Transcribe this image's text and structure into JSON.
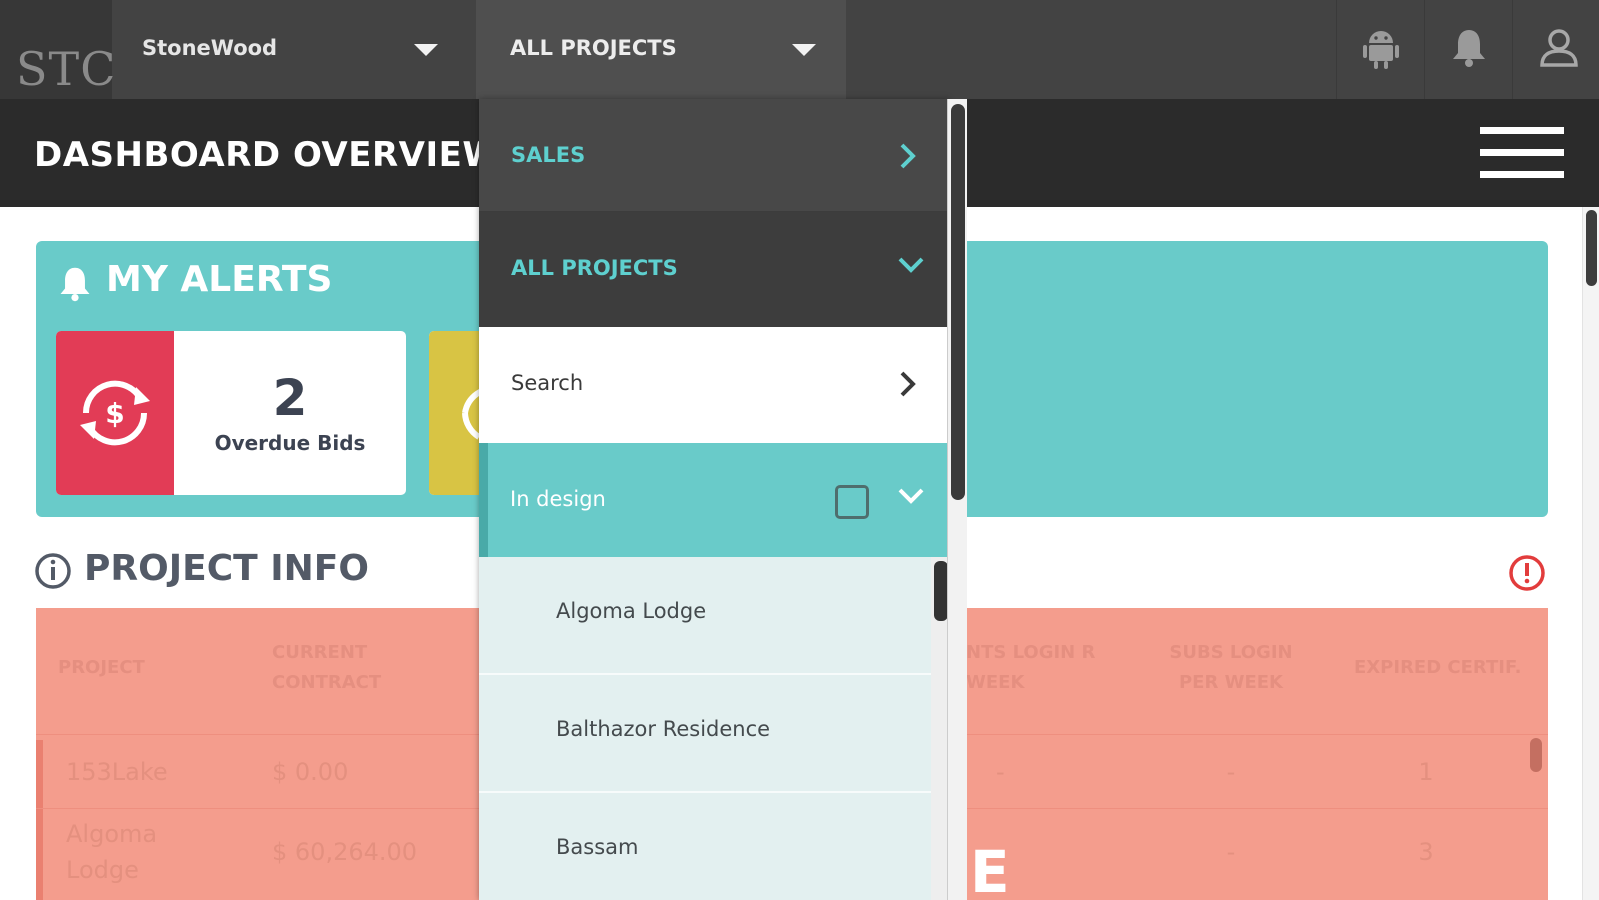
{
  "topbar": {
    "logo": "STC",
    "company_label": "StoneWood",
    "project_select_label": "ALL PROJECTS",
    "icons": [
      "android-icon",
      "bell-icon",
      "user-icon"
    ]
  },
  "title_bar": {
    "title": "DASHBOARD OVERVIEW",
    "menu_icon": "hamburger-icon"
  },
  "alerts": {
    "title": "MY ALERTS",
    "cards": [
      {
        "count": "2",
        "label": "Overdue Bids",
        "color": "#e23c56",
        "icon": "dollar-cycle-icon"
      },
      {
        "count": "",
        "label": "",
        "color": "#d8c444",
        "icon": "cycle-icon"
      }
    ]
  },
  "project_info": {
    "title": "PROJECT INFO",
    "columns": [
      "PROJECT",
      "CURRENT CONTRACT",
      "NTS LOGIN R WEEK",
      "SUBS LOGIN PER WEEK",
      "EXPIRED CERTIF."
    ],
    "rows": [
      {
        "project": "153Lake",
        "contract": "$ 0.00",
        "clients_login": "-",
        "subs_login": "-",
        "expired": "1"
      },
      {
        "project": "Algoma Lodge",
        "contract": "$ 60,264.00",
        "clients_login": "E",
        "subs_login": "-",
        "expired": "3"
      }
    ]
  },
  "dropdown": {
    "sales_label": "SALES",
    "all_projects_label": "ALL PROJECTS",
    "search_label": "Search",
    "group_label": "In design",
    "projects": [
      "Algoma Lodge",
      "Balthazor Residence",
      "Bassam"
    ]
  },
  "colors": {
    "topbar": "#434343",
    "titlebar": "#2b2b2b",
    "teal": "#69cbc9",
    "salmon": "#f49d8d",
    "alert_red": "#e23c56",
    "alert_yellow": "#d8c444"
  }
}
